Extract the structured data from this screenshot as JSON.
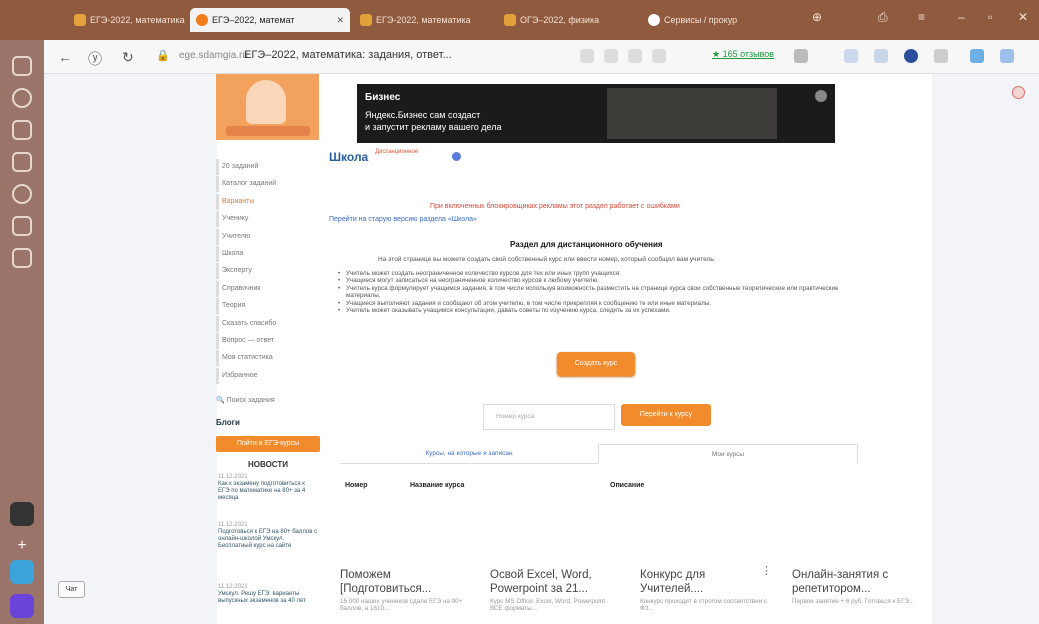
{
  "browser": {
    "tabs": [
      {
        "label": "ЕГЭ-2022, математика"
      },
      {
        "label": "ЕГЭ–2022, математ",
        "active": true
      },
      {
        "label": "ЕГЭ-2022, математика"
      },
      {
        "label": "ОГЭ–2022, физика"
      },
      {
        "label": "Сервисы / прокур"
      }
    ],
    "url_host": "ege.sdamgia.ru",
    "url_title": "ЕГЭ–2022, математика: задания, ответ...",
    "reviews": "★ 165 отзывов"
  },
  "ad": {
    "brand": "Бизнес",
    "line1": "Яндекс.Бизнес сам создаст",
    "line2": "и запустит рекламу вашего дела"
  },
  "sidebar": {
    "items": [
      {
        "label": "20 заданий"
      },
      {
        "label": "Каталог заданий"
      },
      {
        "label": "Варианты"
      },
      {
        "label": "Ученику"
      },
      {
        "label": "Учителю"
      },
      {
        "label": "Школа"
      },
      {
        "label": "Эксперту"
      },
      {
        "label": "Справочник"
      },
      {
        "label": "Теория"
      },
      {
        "label": "Сказать спасибо"
      },
      {
        "label": "Вопрос — ответ"
      },
      {
        "label": "Моя статистика"
      },
      {
        "label": "Избранное"
      }
    ],
    "search": "Поиск задания",
    "blog": "Блоги",
    "button": "Пойти в ЕГЭ-курсы",
    "news_title": "НОВОСТИ",
    "news": [
      {
        "date": "11.12.2021",
        "text": "Как к экзамену подготовиться к ЕГЭ по математике на 80+ за 4 месяца"
      },
      {
        "date": "11.12.2021",
        "text": "Подготовься к ЕГЭ на 80+ баллов с онлайн-школой Умскул. Бесплатный курс на сайте"
      },
      {
        "date": "11.12.2021",
        "text": "Умскул. Решу ЕГЭ: варианты выпускных экзаменов за 40 лет"
      }
    ]
  },
  "main": {
    "title": "Школа",
    "subtitle": "Дистанционное",
    "warning": "При включенных блокировщиках рекламы этот раздел работает с ошибками",
    "old_link": "Перейти на старую версию раздела «Школа»",
    "section_title": "Раздел для дистанционного обучения",
    "intro": "На этой странице вы можете создать свой собственный курс или ввести номер, который сообщил вам учитель.",
    "bullets": [
      "Учитель может создать неограниченное количество курсов для тех или иных групп учащихся.",
      "Учащиеся могут записаться на неограниченное количество курсов к любому учителю.",
      "Учитель курса формулирует учащимся задания, в том числе используя возможность разместить на странице курса свои собственные теоретические или практические материалы.",
      "Учащиеся выполняют задания и сообщают об этом учителю, в том числе прикрепляя к сообщению те или иные материалы.",
      "Учитель может оказывать учащимся консультации, давать советы по изучению курса, следить за их успехами."
    ],
    "create_button": "Создать курс",
    "course_placeholder": "Номер курса",
    "go_button": "Перейти к курсу",
    "tab_left": "Курсы, на которые я записан",
    "tab_right": "Мои курсы",
    "columns": [
      "Номер",
      "Название курса",
      "Описание"
    ]
  },
  "cards": [
    {
      "title": "Поможем [Подготовиться...",
      "desc": "15 000 наших учеников сдали ЕГЭ на 90+ баллов, а 1610..."
    },
    {
      "title": "Освой Excel, Word, Powerpoint за 21...",
      "desc": "Курс MS Office: Excel, Word, Powerpoint. ВСЕ форматы..."
    },
    {
      "title": "Конкурс для Учителей....",
      "desc": "Конкурс проходит в строгом соответствии с ФЗ..."
    },
    {
      "title": "Онлайн-занятия с репетитором...",
      "desc": "Первое занятие + 6 руб. Готовься к ЕГЭ..."
    }
  ],
  "chat_label": "Чат"
}
